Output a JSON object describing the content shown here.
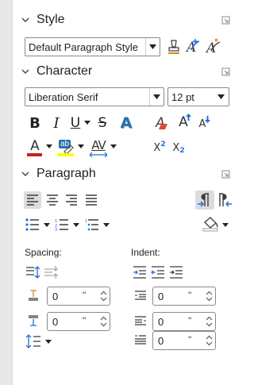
{
  "sections": {
    "style": {
      "title": "Style"
    },
    "character": {
      "title": "Character"
    },
    "paragraph": {
      "title": "Paragraph"
    }
  },
  "style_panel": {
    "paragraph_style": "Default Paragraph Style"
  },
  "character_panel": {
    "font_name": "Liberation Serif",
    "font_size": "12 pt",
    "bold_glyph": "B",
    "italic_glyph": "I",
    "underline_glyph": "U",
    "strike_glyph": "S",
    "shadow_glyph": "A",
    "clear_glyph": "A",
    "grow_glyph": "A",
    "shrink_glyph": "A",
    "font_color_glyph": "A",
    "highlight_glyph": "ab",
    "spacing_glyph": "AV",
    "superscript_base": "X",
    "superscript_exp": "2",
    "subscript_base": "X",
    "subscript_exp": "2"
  },
  "paragraph_panel": {
    "spacing_label": "Spacing:",
    "indent_label": "Indent:",
    "above_spacing": "0",
    "below_spacing": "0",
    "before_indent": "0",
    "after_indent": "0",
    "first_line_indent": "0",
    "unit": "\""
  },
  "colors": {
    "font_color": "#c9211e",
    "highlight": "#ffff00",
    "accent": "#1e6fd9",
    "icon": "#3b3b3b"
  }
}
